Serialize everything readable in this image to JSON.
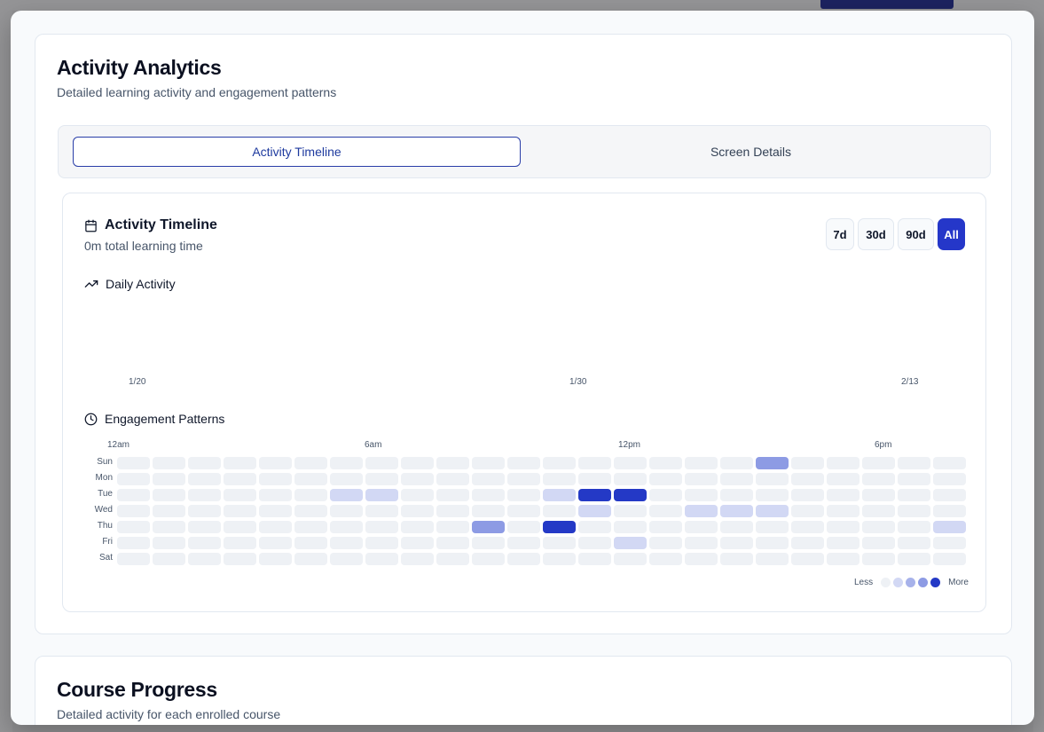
{
  "modal": {
    "analytics": {
      "title": "Activity Analytics",
      "subtitle": "Detailed learning activity and engagement patterns",
      "tabs": [
        {
          "label": "Activity Timeline",
          "active": true
        },
        {
          "label": "Screen Details",
          "active": false
        }
      ],
      "timeline": {
        "title": "Activity Timeline",
        "summary": "0m total learning time",
        "ranges": [
          {
            "label": "7d",
            "active": false
          },
          {
            "label": "30d",
            "active": false
          },
          {
            "label": "90d",
            "active": false
          },
          {
            "label": "All",
            "active": true
          }
        ],
        "daily_activity": {
          "title": "Daily Activity",
          "x_ticks": [
            "1/20",
            "1/30",
            "2/13"
          ]
        },
        "engagement": {
          "title": "Engagement Patterns",
          "hour_labels": [
            "12am",
            "6am",
            "12pm",
            "6pm"
          ],
          "days": [
            "Sun",
            "Mon",
            "Tue",
            "Wed",
            "Thu",
            "Fri",
            "Sat"
          ],
          "hours_per_day": 24,
          "levels": [
            [
              0,
              0,
              0,
              0,
              0,
              0,
              0,
              0,
              0,
              0,
              0,
              0,
              0,
              0,
              0,
              0,
              0,
              0,
              3,
              0,
              0,
              0,
              0,
              0
            ],
            [
              0,
              0,
              0,
              0,
              0,
              0,
              0,
              0,
              0,
              0,
              0,
              0,
              0,
              0,
              0,
              0,
              0,
              0,
              0,
              0,
              0,
              0,
              0,
              0
            ],
            [
              0,
              0,
              0,
              0,
              0,
              0,
              1,
              1,
              0,
              0,
              0,
              0,
              1,
              4,
              4,
              0,
              0,
              0,
              0,
              0,
              0,
              0,
              0,
              0
            ],
            [
              0,
              0,
              0,
              0,
              0,
              0,
              0,
              0,
              0,
              0,
              0,
              0,
              0,
              1,
              0,
              0,
              1,
              1,
              1,
              0,
              0,
              0,
              0,
              0
            ],
            [
              0,
              0,
              0,
              0,
              0,
              0,
              0,
              0,
              0,
              0,
              3,
              0,
              4,
              0,
              0,
              0,
              0,
              0,
              0,
              0,
              0,
              0,
              0,
              1
            ],
            [
              0,
              0,
              0,
              0,
              0,
              0,
              0,
              0,
              0,
              0,
              0,
              0,
              0,
              0,
              1,
              0,
              0,
              0,
              0,
              0,
              0,
              0,
              0,
              0
            ],
            [
              0,
              0,
              0,
              0,
              0,
              0,
              0,
              0,
              0,
              0,
              0,
              0,
              0,
              0,
              0,
              0,
              0,
              0,
              0,
              0,
              0,
              0,
              0,
              0
            ]
          ],
          "legend": {
            "less": "Less",
            "more": "More"
          },
          "level_colors": [
            "#eef1f5",
            "#d2d8f4",
            "#a7b2ea",
            "#8d9be4",
            "#2439c6"
          ]
        }
      }
    },
    "course_progress": {
      "title": "Course Progress",
      "subtitle": "Detailed activity for each enrolled course"
    }
  }
}
